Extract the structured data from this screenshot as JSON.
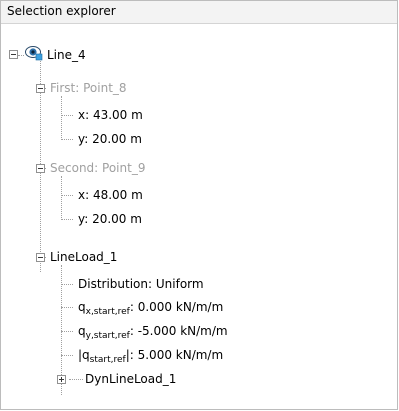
{
  "panel": {
    "title": "Selection explorer"
  },
  "tree": {
    "root": {
      "label": "Line_4",
      "icon": "line-eye-icon"
    },
    "first": {
      "label": "First: Point_8",
      "x": "x: 43.00 m",
      "y": "y: 20.00 m"
    },
    "second": {
      "label": "Second: Point_9",
      "x": "x: 48.00 m",
      "y": "y: 20.00 m"
    },
    "lineload": {
      "label": "LineLoad_1",
      "distribution": "Distribution: Uniform",
      "qx": {
        "prefix": "q",
        "sub": "x,start,ref",
        "value": ": 0.000 kN/m/m"
      },
      "qy": {
        "prefix": "q",
        "sub": "y,start,ref",
        "value": ": -5.000 kN/m/m"
      },
      "qabs": {
        "prefix": "|q",
        "sub": "start,ref",
        "value": "|: 5.000 kN/m/m"
      },
      "dyn": "DynLineLoad_1"
    }
  }
}
